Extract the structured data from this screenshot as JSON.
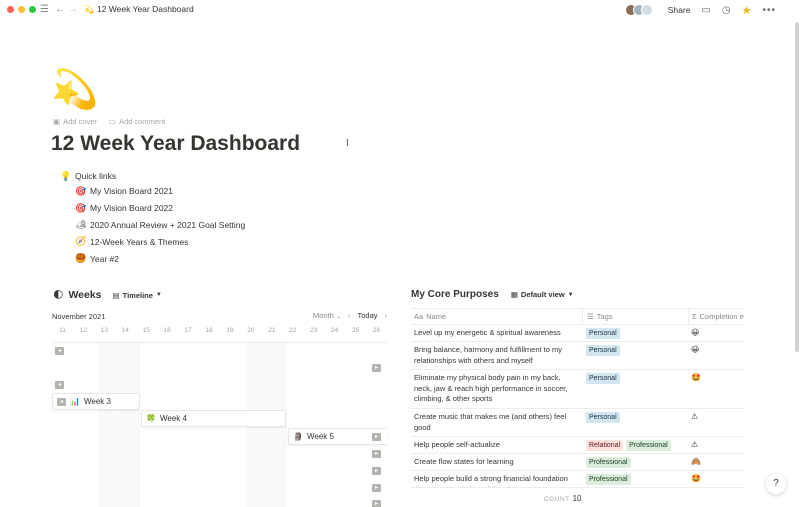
{
  "window": {
    "title": "12 Week Year Dashboard",
    "title_icon": "shooting-star-emoji",
    "share_label": "Share"
  },
  "page": {
    "emoji": "💫",
    "add_cover": "Add cover",
    "add_comment": "Add comment",
    "title": "12 Week Year Dashboard"
  },
  "quick_links": {
    "title": "Quick links",
    "icon": "💡",
    "items": [
      {
        "emoji": "🎯",
        "label": "My Vision Board 2021"
      },
      {
        "emoji": "🎯",
        "label": "My Vision Board 2022"
      },
      {
        "emoji": "🏕",
        "label": "2020 Annual Review + 2021 Goal Setting"
      },
      {
        "emoji": "🧭",
        "label": "12-Week Years & Themes"
      },
      {
        "emoji": "🥮",
        "label": "Year #2"
      }
    ]
  },
  "weeks": {
    "emoji": "🌓",
    "title": "Weeks",
    "view_label": "Timeline",
    "month": "November 2021",
    "scale_label": "Month",
    "today_label": "Today",
    "days": [
      "11",
      "12",
      "13",
      "14",
      "15",
      "16",
      "17",
      "18",
      "19",
      "20",
      "21",
      "22",
      "23",
      "24",
      "25",
      "26"
    ],
    "cards": [
      {
        "emoji": "📊",
        "label": "Week 3"
      },
      {
        "emoji": "🍀",
        "label": "Week 4"
      },
      {
        "emoji": "🗿",
        "label": "Week 5"
      }
    ]
  },
  "core_purposes": {
    "title": "My Core Purposes",
    "view_label": "Default view",
    "columns": {
      "name": "Name",
      "tags": "Tags",
      "completion": "Completion e"
    },
    "rows": [
      {
        "name": "Level up my energetic & spiritual awareness",
        "tags": [
          "Personal"
        ],
        "completion": "😀"
      },
      {
        "name": "Bring balance, harmony and fulfillment to my relationships with others and myself",
        "tags": [
          "Personal"
        ],
        "completion": "😀"
      },
      {
        "name": "Eliminate my physical body pain in my back, neck, jaw & reach high performance in soccer, climbing, & other sports",
        "tags": [
          "Personal"
        ],
        "completion": "🤩"
      },
      {
        "name": "Create music that makes me (and others) feel good",
        "tags": [
          "Personal"
        ],
        "completion": "⚠"
      },
      {
        "name": "Help people self-actualize",
        "tags": [
          "Relational",
          "Professional"
        ],
        "completion": "⚠"
      },
      {
        "name": "Create flow states for learning",
        "tags": [
          "Professional"
        ],
        "completion": "🙈"
      },
      {
        "name": "Help people build a strong financial foundation that supports their social and...",
        "tags": [
          "Professional"
        ],
        "completion": "🤩"
      }
    ],
    "count_label": "COUNT",
    "count_value": "10"
  },
  "help_label": "?"
}
